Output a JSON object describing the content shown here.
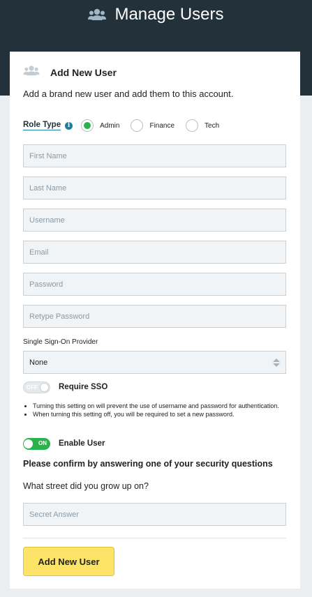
{
  "header": {
    "title": "Manage Users",
    "icon": "users-icon"
  },
  "card": {
    "title": "Add New User",
    "icon": "users-icon",
    "subtitle": "Add a brand new user and add them to this account."
  },
  "role": {
    "label": "Role Type",
    "info_icon_glyph": "i",
    "options": [
      {
        "label": "Admin",
        "selected": true
      },
      {
        "label": "Finance",
        "selected": false
      },
      {
        "label": "Tech",
        "selected": false
      }
    ]
  },
  "fields": {
    "first_name": {
      "placeholder": "First Name",
      "value": ""
    },
    "last_name": {
      "placeholder": "Last Name",
      "value": ""
    },
    "username": {
      "placeholder": "Username",
      "value": ""
    },
    "email": {
      "placeholder": "Email",
      "value": ""
    },
    "password": {
      "placeholder": "Password",
      "value": ""
    },
    "retype_password": {
      "placeholder": "Retype Password",
      "value": ""
    }
  },
  "sso": {
    "label": "Single Sign-On Provider",
    "selected": "None",
    "require_toggle": {
      "state_text": "OFF",
      "label": "Require SSO",
      "on": false
    },
    "notes": [
      "Turning this setting on will prevent the use of username and password for authentication.",
      "When turning this setting off, you will be required to set a new password."
    ]
  },
  "enable_user": {
    "state_text": "ON",
    "label": "Enable User",
    "on": true
  },
  "security": {
    "prompt": "Please confirm by answering one of your security questions",
    "question": "What street did you grow up on?",
    "answer_placeholder": "Secret Answer"
  },
  "submit_label": "Add New User",
  "colors": {
    "header_bg": "#22313a",
    "accent_green": "#2cb24d",
    "button_yellow": "#fde468",
    "link_blue": "#1a7fa0"
  }
}
